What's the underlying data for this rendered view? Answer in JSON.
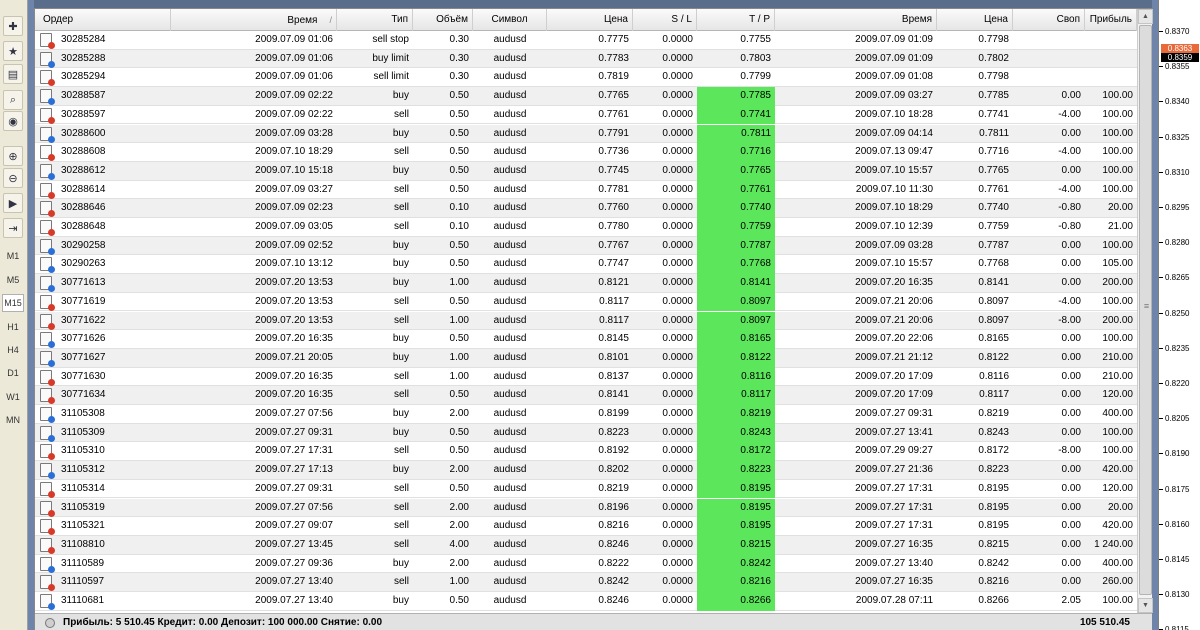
{
  "columns": [
    {
      "label": "Ордер",
      "align": "left"
    },
    {
      "label": "Время",
      "align": "right",
      "sorted": true
    },
    {
      "label": "Тип",
      "align": "right"
    },
    {
      "label": "Объём",
      "align": "right"
    },
    {
      "label": "Символ",
      "align": "center"
    },
    {
      "label": "Цена",
      "align": "right"
    },
    {
      "label": "S / L",
      "align": "right"
    },
    {
      "label": "T / P",
      "align": "right"
    },
    {
      "label": "Время",
      "align": "right"
    },
    {
      "label": "Цена",
      "align": "right"
    },
    {
      "label": "Своп",
      "align": "right"
    },
    {
      "label": "Прибыль",
      "align": "right"
    }
  ],
  "sort_indicator": "/",
  "rows": [
    [
      "30285284",
      "2009.07.09 01:06",
      "sell stop",
      "0.30",
      "audusd",
      "0.7775",
      "0.0000",
      "0.7755",
      "2009.07.09 01:09",
      "0.7798",
      "",
      ""
    ],
    [
      "30285288",
      "2009.07.09 01:06",
      "buy limit",
      "0.30",
      "audusd",
      "0.7783",
      "0.0000",
      "0.7803",
      "2009.07.09 01:09",
      "0.7802",
      "",
      ""
    ],
    [
      "30285294",
      "2009.07.09 01:06",
      "sell limit",
      "0.30",
      "audusd",
      "0.7819",
      "0.0000",
      "0.7799",
      "2009.07.09 01:08",
      "0.7798",
      "",
      ""
    ],
    [
      "30288587",
      "2009.07.09 02:22",
      "buy",
      "0.50",
      "audusd",
      "0.7765",
      "0.0000",
      "0.7785",
      "2009.07.09 03:27",
      "0.7785",
      "0.00",
      "100.00"
    ],
    [
      "30288597",
      "2009.07.09 02:22",
      "sell",
      "0.50",
      "audusd",
      "0.7761",
      "0.0000",
      "0.7741",
      "2009.07.10 18:28",
      "0.7741",
      "-4.00",
      "100.00"
    ],
    [
      "30288600",
      "2009.07.09 03:28",
      "buy",
      "0.50",
      "audusd",
      "0.7791",
      "0.0000",
      "0.7811",
      "2009.07.09 04:14",
      "0.7811",
      "0.00",
      "100.00"
    ],
    [
      "30288608",
      "2009.07.10 18:29",
      "sell",
      "0.50",
      "audusd",
      "0.7736",
      "0.0000",
      "0.7716",
      "2009.07.13 09:47",
      "0.7716",
      "-4.00",
      "100.00"
    ],
    [
      "30288612",
      "2009.07.10 15:18",
      "buy",
      "0.50",
      "audusd",
      "0.7745",
      "0.0000",
      "0.7765",
      "2009.07.10 15:57",
      "0.7765",
      "0.00",
      "100.00"
    ],
    [
      "30288614",
      "2009.07.09 03:27",
      "sell",
      "0.50",
      "audusd",
      "0.7781",
      "0.0000",
      "0.7761",
      "2009.07.10 11:30",
      "0.7761",
      "-4.00",
      "100.00"
    ],
    [
      "30288646",
      "2009.07.09 02:23",
      "sell",
      "0.10",
      "audusd",
      "0.7760",
      "0.0000",
      "0.7740",
      "2009.07.10 18:29",
      "0.7740",
      "-0.80",
      "20.00"
    ],
    [
      "30288648",
      "2009.07.09 03:05",
      "sell",
      "0.10",
      "audusd",
      "0.7780",
      "0.0000",
      "0.7759",
      "2009.07.10 12:39",
      "0.7759",
      "-0.80",
      "21.00"
    ],
    [
      "30290258",
      "2009.07.09 02:52",
      "buy",
      "0.50",
      "audusd",
      "0.7767",
      "0.0000",
      "0.7787",
      "2009.07.09 03:28",
      "0.7787",
      "0.00",
      "100.00"
    ],
    [
      "30290263",
      "2009.07.10 13:12",
      "buy",
      "0.50",
      "audusd",
      "0.7747",
      "0.0000",
      "0.7768",
      "2009.07.10 15:57",
      "0.7768",
      "0.00",
      "105.00"
    ],
    [
      "30771613",
      "2009.07.20 13:53",
      "buy",
      "1.00",
      "audusd",
      "0.8121",
      "0.0000",
      "0.8141",
      "2009.07.20 16:35",
      "0.8141",
      "0.00",
      "200.00"
    ],
    [
      "30771619",
      "2009.07.20 13:53",
      "sell",
      "0.50",
      "audusd",
      "0.8117",
      "0.0000",
      "0.8097",
      "2009.07.21 20:06",
      "0.8097",
      "-4.00",
      "100.00"
    ],
    [
      "30771622",
      "2009.07.20 13:53",
      "sell",
      "1.00",
      "audusd",
      "0.8117",
      "0.0000",
      "0.8097",
      "2009.07.21 20:06",
      "0.8097",
      "-8.00",
      "200.00"
    ],
    [
      "30771626",
      "2009.07.20 16:35",
      "buy",
      "0.50",
      "audusd",
      "0.8145",
      "0.0000",
      "0.8165",
      "2009.07.20 22:06",
      "0.8165",
      "0.00",
      "100.00"
    ],
    [
      "30771627",
      "2009.07.21 20:05",
      "buy",
      "1.00",
      "audusd",
      "0.8101",
      "0.0000",
      "0.8122",
      "2009.07.21 21:12",
      "0.8122",
      "0.00",
      "210.00"
    ],
    [
      "30771630",
      "2009.07.20 16:35",
      "sell",
      "1.00",
      "audusd",
      "0.8137",
      "0.0000",
      "0.8116",
      "2009.07.20 17:09",
      "0.8116",
      "0.00",
      "210.00"
    ],
    [
      "30771634",
      "2009.07.20 16:35",
      "sell",
      "0.50",
      "audusd",
      "0.8141",
      "0.0000",
      "0.8117",
      "2009.07.20 17:09",
      "0.8117",
      "0.00",
      "120.00"
    ],
    [
      "31105308",
      "2009.07.27 07:56",
      "buy",
      "2.00",
      "audusd",
      "0.8199",
      "0.0000",
      "0.8219",
      "2009.07.27 09:31",
      "0.8219",
      "0.00",
      "400.00"
    ],
    [
      "31105309",
      "2009.07.27 09:31",
      "buy",
      "0.50",
      "audusd",
      "0.8223",
      "0.0000",
      "0.8243",
      "2009.07.27 13:41",
      "0.8243",
      "0.00",
      "100.00"
    ],
    [
      "31105310",
      "2009.07.27 17:31",
      "sell",
      "0.50",
      "audusd",
      "0.8192",
      "0.0000",
      "0.8172",
      "2009.07.29 09:27",
      "0.8172",
      "-8.00",
      "100.00"
    ],
    [
      "31105312",
      "2009.07.27 17:13",
      "buy",
      "2.00",
      "audusd",
      "0.8202",
      "0.0000",
      "0.8223",
      "2009.07.27 21:36",
      "0.8223",
      "0.00",
      "420.00"
    ],
    [
      "31105314",
      "2009.07.27 09:31",
      "sell",
      "0.50",
      "audusd",
      "0.8219",
      "0.0000",
      "0.8195",
      "2009.07.27 17:31",
      "0.8195",
      "0.00",
      "120.00"
    ],
    [
      "31105319",
      "2009.07.27 07:56",
      "sell",
      "2.00",
      "audusd",
      "0.8196",
      "0.0000",
      "0.8195",
      "2009.07.27 17:31",
      "0.8195",
      "0.00",
      "20.00"
    ],
    [
      "31105321",
      "2009.07.27 09:07",
      "sell",
      "2.00",
      "audusd",
      "0.8216",
      "0.0000",
      "0.8195",
      "2009.07.27 17:31",
      "0.8195",
      "0.00",
      "420.00"
    ],
    [
      "31108810",
      "2009.07.27 13:45",
      "sell",
      "4.00",
      "audusd",
      "0.8246",
      "0.0000",
      "0.8215",
      "2009.07.27 16:35",
      "0.8215",
      "0.00",
      "1 240.00"
    ],
    [
      "31110589",
      "2009.07.27 09:36",
      "buy",
      "2.00",
      "audusd",
      "0.8222",
      "0.0000",
      "0.8242",
      "2009.07.27 13:40",
      "0.8242",
      "0.00",
      "400.00"
    ],
    [
      "31110597",
      "2009.07.27 13:40",
      "sell",
      "1.00",
      "audusd",
      "0.8242",
      "0.0000",
      "0.8216",
      "2009.07.27 16:35",
      "0.8216",
      "0.00",
      "260.00"
    ],
    [
      "31110681",
      "2009.07.27 13:40",
      "buy",
      "0.50",
      "audusd",
      "0.8246",
      "0.0000",
      "0.8266",
      "2009.07.28 07:11",
      "0.8266",
      "2.05",
      "100.00"
    ]
  ],
  "tp_highlight_from_row": 3,
  "tp_highlight_color": "#5ce65c",
  "status": {
    "summary": "Прибыль: 5 510.45  Кредит: 0.00  Депозит: 100 000.00  Снятие: 0.00",
    "total": "105 510.45"
  },
  "timeframes": [
    "M1",
    "M5",
    "M15",
    "H1",
    "H4",
    "D1",
    "W1",
    "MN"
  ],
  "active_timeframe": "M15",
  "toolbar_icons": [
    "new-chart-icon",
    "profiles-icon",
    "market-watch-icon",
    "navigator-icon",
    "terminal-icon",
    "zoom-in-icon",
    "zoom-out-icon",
    "autoscroll-icon",
    "chart-shift-icon"
  ],
  "price_axis": {
    "ticks": [
      "0.8370",
      "0.8355",
      "0.8340",
      "0.8325",
      "0.8310",
      "0.8295",
      "0.8280",
      "0.8265",
      "0.8250",
      "0.8235",
      "0.8220",
      "0.8205",
      "0.8190",
      "0.8175",
      "0.8160",
      "0.8145",
      "0.8130",
      "0.8115"
    ],
    "price_tags": [
      {
        "text": "0.8363",
        "bg": "#e8693a",
        "color": "#ffffff"
      },
      {
        "text": "0.8359",
        "bg": "#000000",
        "color": "#ffffff"
      }
    ]
  }
}
